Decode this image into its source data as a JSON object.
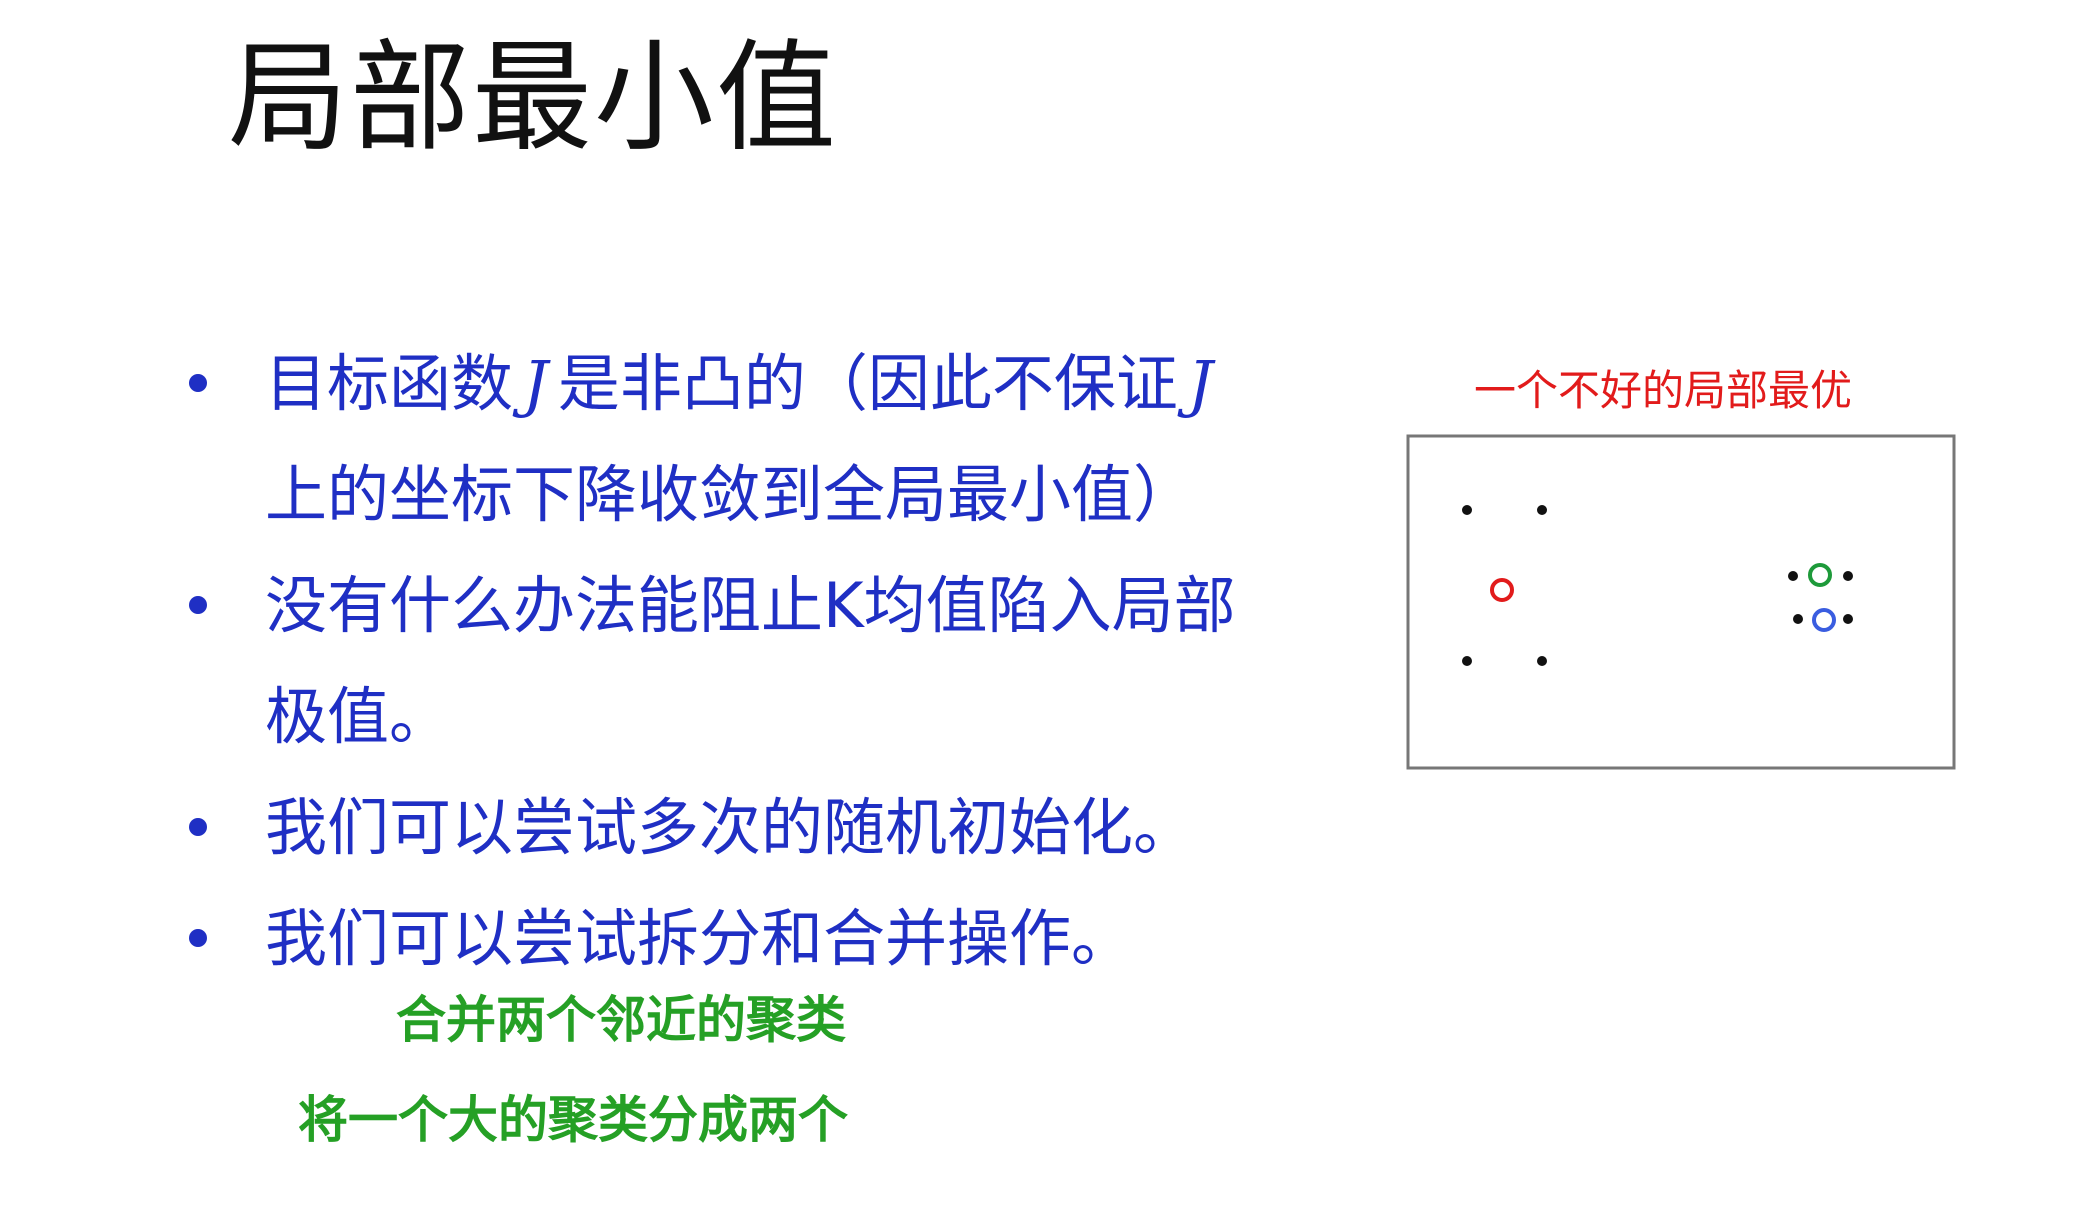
{
  "title": "局部最小值",
  "bullets": [
    {
      "text_before_j": "目标函数",
      "var": "J",
      "text_mid": "是非凸的（因此不保证",
      "var2": "J",
      "line2": "上的坐标下降收敛到全局最小值）"
    },
    {
      "line1": "没有什么办法能阻止K均值陷入局部",
      "line2": "极值。"
    },
    {
      "line1": "我们可以尝试多次的随机初始化。"
    },
    {
      "line1": "我们可以尝试拆分和合并操作。"
    }
  ],
  "notes": {
    "merge": "合并两个邻近的聚类",
    "split": "将一个大的聚类分成两个"
  },
  "figure": {
    "caption": "一个不好的局部最优",
    "colors": {
      "point": "#111111",
      "center_red": "#e21b1b",
      "center_green": "#1e9a3a",
      "center_blue": "#3a5de0",
      "border": "#777777",
      "caption": "#e21b1b",
      "bullet_text": "#1f2fc4",
      "note_text": "#25a025"
    }
  }
}
